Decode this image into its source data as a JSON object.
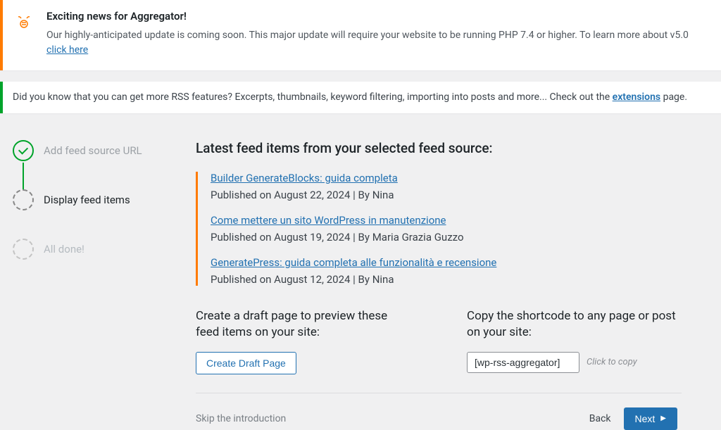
{
  "notice_aggregator": {
    "heading": "Exciting news for Aggregator!",
    "text": "Our highly-anticipated update is coming soon. This major update will require your website to be running PHP 7.4 or higher. To learn more about v5.0 ",
    "link": "click here"
  },
  "notice_extensions": {
    "prefix": "Did you know that you can get more RSS features? Excerpts, thumbnails, keyword filtering, importing into posts and more... Check out the ",
    "link": "extensions",
    "suffix": " page."
  },
  "steps": [
    {
      "label": "Add feed source URL",
      "state": "done"
    },
    {
      "label": "Display feed items",
      "state": "active"
    },
    {
      "label": "All done!",
      "state": "upcoming"
    }
  ],
  "main": {
    "heading": "Latest feed items from your selected feed source:",
    "feed_items": [
      {
        "title": "Builder GenerateBlocks: guida completa",
        "meta": "Published on August 22, 2024 | By Nina"
      },
      {
        "title": "Come mettere un sito WordPress in manutenzione",
        "meta": "Published on August 19, 2024 | By Maria Grazia Guzzo"
      },
      {
        "title": "GeneratePress: guida completa alle funzionalità e recensione",
        "meta": "Published on August 12, 2024 | By Nina"
      }
    ]
  },
  "actions": {
    "draft_heading": "Create a draft page to preview these feed items on your site:",
    "draft_button": "Create Draft Page",
    "shortcode_heading": "Copy the shortcode to any page or post on your site:",
    "shortcode_value": "[wp-rss-aggregator]",
    "copy_hint": "Click to copy"
  },
  "footer": {
    "skip": "Skip the introduction",
    "back": "Back",
    "next": "Next"
  }
}
